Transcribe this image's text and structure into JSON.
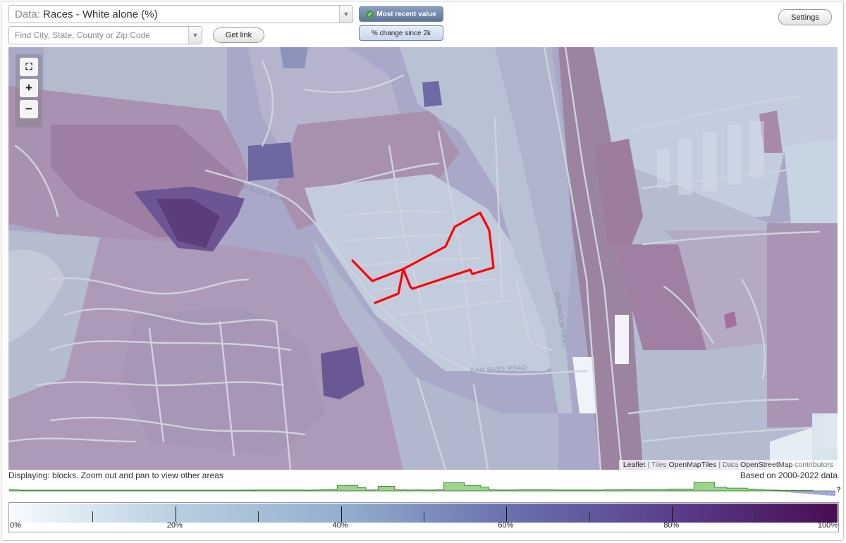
{
  "header": {
    "data_label": "Data:",
    "data_value": "Races - White alone (%)",
    "search_placeholder": "Find City, State, County or Zip Code",
    "get_link_label": "Get link",
    "mode_recent_label": "Most recent value",
    "mode_change_label": "% change since 2k",
    "settings_label": "Settings"
  },
  "map": {
    "road_labels": [
      "SAM BASS ROAD",
      "SAM BASS ROAD",
      "CHISHOLM TRAIL"
    ],
    "attribution": {
      "leaflet": "Leaflet",
      "tiles_prefix": "| Tiles",
      "tiles": "OpenMapTiles",
      "data_prefix": "| Data",
      "data": "OpenStreetMap",
      "suffix": "contributors"
    }
  },
  "status": {
    "displaying": "Displaying: blocks. Zoom out and pan to view other areas",
    "based_on": "Based on 2000-2022 data"
  },
  "histogram": {
    "values": [
      0.13,
      0.12,
      0.1,
      0.08,
      0.08,
      0.08,
      0.08,
      0.08,
      0.08,
      0.08,
      0.08,
      0.08,
      0.08,
      0.08,
      0.08,
      0.08,
      0.08,
      0.08,
      0.08,
      0.08,
      0.08,
      0.08,
      0.08,
      0.08,
      0.08,
      0.08,
      0.08,
      0.08,
      0.08,
      0.08,
      0.08,
      0.08,
      0.08,
      0.08,
      0.08,
      0.08,
      0.08,
      0.08,
      0.08,
      0.08,
      0.08,
      0.08,
      0.08,
      0.08,
      0.08,
      0.08,
      0.08,
      0.08,
      0.08,
      0.08,
      0.08,
      0.08,
      0.08,
      0.08,
      0.08,
      0.08,
      0.08,
      0.08,
      0.1,
      0.08,
      0.1,
      0.1,
      0.1,
      0.1,
      0.1,
      0.1,
      0.1,
      0.1,
      0.1,
      0.1,
      0.1,
      0.1,
      0.08,
      0.08,
      0.1,
      0.1,
      0.12,
      0.14,
      0.16,
      0.16,
      0.6,
      0.6,
      0.6,
      0.6,
      0.6,
      0.35,
      0.35,
      0.1,
      0.1,
      0.12,
      0.5,
      0.5,
      0.5,
      0.5,
      0.12,
      0.1,
      0.12,
      0.1,
      0.1,
      0.12,
      0.1,
      0.1,
      0.1,
      0.1,
      0.12,
      0.14,
      0.9,
      0.9,
      0.9,
      0.9,
      0.9,
      0.6,
      0.6,
      0.6,
      0.6,
      0.4,
      0.4,
      0.12,
      0.12,
      0.1,
      0.1,
      0.1,
      0.1,
      0.1,
      0.12,
      0.12,
      0.12,
      0.12,
      0.12,
      0.12,
      0.12,
      0.12,
      0.12,
      0.1,
      0.1,
      0.1,
      0.1,
      0.1,
      0.1,
      0.1,
      0.1,
      0.1,
      0.1,
      0.1,
      0.1,
      0.12,
      0.12,
      0.12,
      0.14,
      0.14,
      0.16,
      0.16,
      0.16,
      0.16,
      0.16,
      0.16,
      0.16,
      0.16,
      0.16,
      0.16,
      0.16,
      0.2,
      0.2,
      0.2,
      0.2,
      0.2,
      0.2,
      0.95,
      0.95,
      0.95,
      0.95,
      0.95,
      0.4,
      0.4,
      0.4,
      0.3,
      0.3,
      0.3,
      0.3,
      0.3,
      0.2,
      0.2,
      0.15,
      0.15,
      0.1,
      0.1,
      0.08,
      0.08,
      0.06,
      0.06,
      0.06,
      0.06,
      0.05,
      0.05,
      0.05,
      0.05
    ],
    "right_tail": [
      0.05,
      0.1,
      0.15,
      0.2,
      0.25,
      0.3,
      0.35,
      0.4,
      0.45,
      0.5,
      0.55
    ],
    "question_mark": "?",
    "colors": {
      "positive": "#9ed28f",
      "tail": "#a9a6d6"
    }
  },
  "legend": {
    "min": 0,
    "max": 100,
    "ticks": [
      10,
      20,
      30,
      40,
      50,
      60,
      70,
      80,
      90
    ],
    "labels": [
      {
        "value": 0,
        "text": "0%"
      },
      {
        "value": 20,
        "text": "20%"
      },
      {
        "value": 40,
        "text": "40%"
      },
      {
        "value": 60,
        "text": "60%"
      },
      {
        "value": 80,
        "text": "80%"
      },
      {
        "value": 100,
        "text": "100%"
      }
    ]
  }
}
